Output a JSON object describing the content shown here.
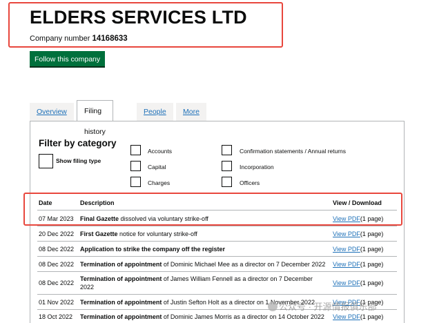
{
  "company": {
    "name": "ELDERS SERVICES LTD",
    "number_label": "Company number",
    "number": "14168633"
  },
  "follow_label": "Follow this company",
  "tabs": [
    {
      "label": "Overview"
    },
    {
      "label": "Filing history"
    },
    {
      "label": "People"
    },
    {
      "label": "More"
    }
  ],
  "filter": {
    "title": "Filter by category",
    "show_label": "Show filing type",
    "categories": [
      "Accounts",
      "Capital",
      "Charges",
      "Confirmation statements / Annual returns",
      "Incorporation",
      "Officers"
    ]
  },
  "table": {
    "headers": {
      "date": "Date",
      "description": "Description",
      "view": "View / Download"
    },
    "rows": [
      {
        "date": "07 Mar 2023",
        "title": "Final Gazette",
        "rest": " dissolved via voluntary strike-off",
        "link": "View PDF",
        "pages": "(1 page)"
      },
      {
        "date": "20 Dec 2022",
        "title": "First Gazette",
        "rest": " notice for voluntary strike-off",
        "link": "View PDF",
        "pages": "(1 page)"
      },
      {
        "date": "08 Dec 2022",
        "title": "Application to strike the company off the register",
        "rest": "",
        "link": "View PDF",
        "pages": "(1 page)"
      },
      {
        "date": "08 Dec 2022",
        "title": "Termination of appointment",
        "rest": " of Dominic Michael Mee as a director on 7 December 2022",
        "link": "View PDF",
        "pages": "(1 page)"
      },
      {
        "date": "08 Dec 2022",
        "title": "Termination of appointment",
        "rest": " of James William Fennell as a director on 7 December 2022",
        "link": "View PDF",
        "pages": "(1 page)"
      },
      {
        "date": "01 Nov 2022",
        "title": "Termination of appointment",
        "rest": " of Justin Sefton Holt as a director on 1 November 2022",
        "link": "View PDF",
        "pages": "(1 page)"
      },
      {
        "date": "18 Oct 2022",
        "title": "Termination of appointment",
        "rest": " of Dominic James Morris as a director on 14 October 2022",
        "link": "View PDF",
        "pages": "(1 page)"
      }
    ]
  },
  "watermark": "公众号 · 开源情报俱乐部",
  "colors": {
    "accent_green": "#00703c",
    "link_blue": "#1d70b8",
    "highlight_red": "#e8463c"
  }
}
